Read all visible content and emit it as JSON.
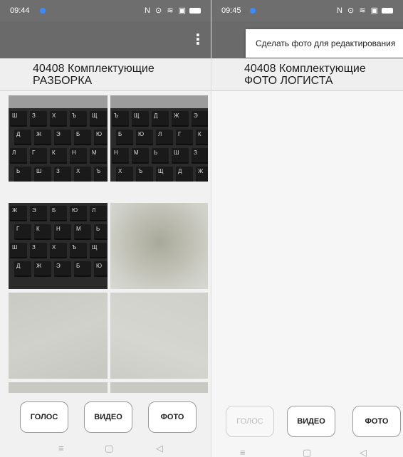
{
  "left": {
    "status": {
      "time": "09:44",
      "icons": "N ⊙ ≋ ▣"
    },
    "header": {
      "line1": "40408 Комплектующие",
      "line2": "РАЗБОРКА"
    },
    "buttons": {
      "voice": "ГОЛОС",
      "video": "ВИДЕО",
      "photo": "ФОТО"
    }
  },
  "right": {
    "status": {
      "time": "09:45",
      "icons": "N ⊙ ≋ ▣"
    },
    "popup": {
      "label": "Сделать фото для редактирования"
    },
    "header": {
      "line1": "40408 Комплектующие",
      "line2": "ФОТО ЛОГИСТА"
    },
    "buttons": {
      "voice": "ГОЛОС",
      "video": "ВИДЕО",
      "photo": "ФОТО"
    }
  },
  "keyboard_keys": [
    "Ш",
    "З",
    "Х",
    "Ъ",
    "Щ",
    "Д",
    "Ж",
    "Э",
    "Б",
    "Ю",
    "Л",
    "Г",
    "К",
    "Н",
    "М",
    "Ь"
  ],
  "colors": {
    "appbar": "#6a6a6a",
    "statusbar": "#6e6e6e",
    "accent_dot": "#3b8bff"
  }
}
